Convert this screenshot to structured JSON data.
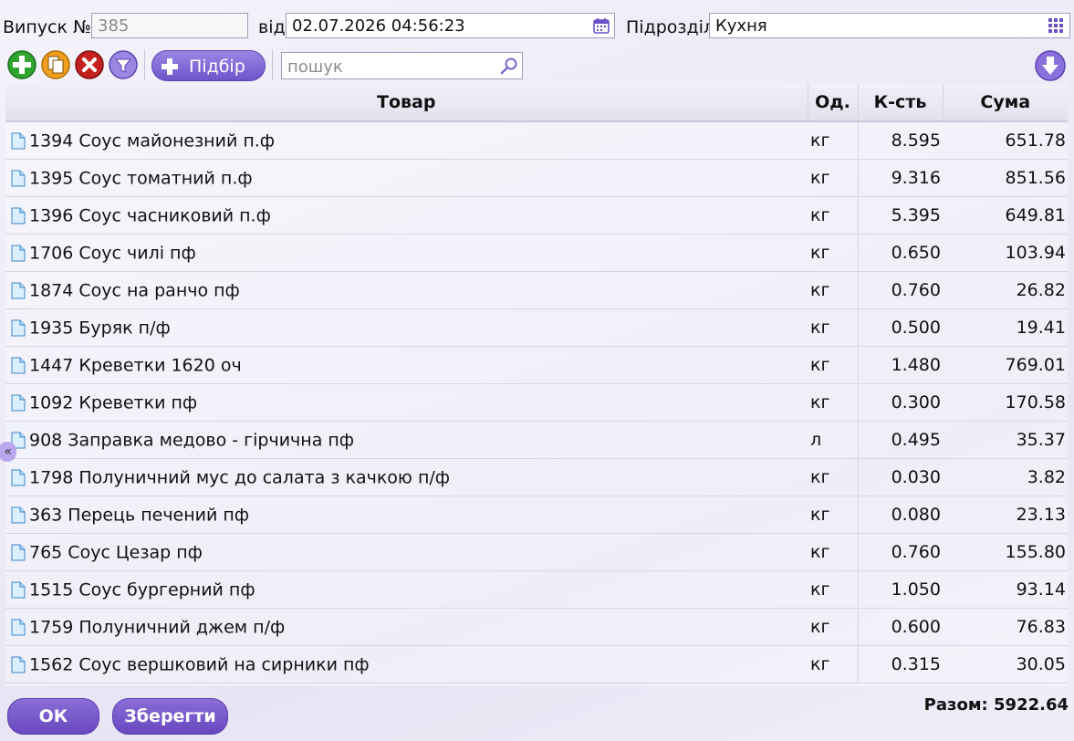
{
  "header": {
    "issue_label": "Випуск №",
    "issue_number": "385",
    "date_label": "від",
    "date_value": "02.07.2026 04:56:23",
    "dept_label": "Підрозділ",
    "dept_value": "Кухня"
  },
  "toolbar": {
    "add_icon": "plus-circle-icon",
    "copy_icon": "copy-icon",
    "delete_icon": "delete-x-icon",
    "filter_icon": "filter-funnel-icon",
    "pick_label": "Підбір",
    "search_placeholder": "пошук",
    "download_icon": "arrow-down-icon"
  },
  "table": {
    "columns": [
      "Товар",
      "Од.",
      "К-сть",
      "Сума"
    ],
    "rows": [
      {
        "name": "1394 Соус майонезний п.ф",
        "unit": "кг",
        "qty": "8.595",
        "sum": "651.78"
      },
      {
        "name": "1395 Соус томатний п.ф",
        "unit": "кг",
        "qty": "9.316",
        "sum": "851.56"
      },
      {
        "name": "1396 Соус часниковий п.ф",
        "unit": "кг",
        "qty": "5.395",
        "sum": "649.81"
      },
      {
        "name": "1706 Соус чилі пф",
        "unit": "кг",
        "qty": "0.650",
        "sum": "103.94"
      },
      {
        "name": "1874 Соус на ранчо пф",
        "unit": "кг",
        "qty": "0.760",
        "sum": "26.82"
      },
      {
        "name": "1935 Буряк п/ф",
        "unit": "кг",
        "qty": "0.500",
        "sum": "19.41"
      },
      {
        "name": "1447 Креветки 1620 оч",
        "unit": "кг",
        "qty": "1.480",
        "sum": "769.01"
      },
      {
        "name": "1092 Креветки пф",
        "unit": "кг",
        "qty": "0.300",
        "sum": "170.58"
      },
      {
        "name": "908 Заправка медово - гірчична пф",
        "unit": "л",
        "qty": "0.495",
        "sum": "35.37"
      },
      {
        "name": "1798 Полуничний мус до салата з качкою п/ф",
        "unit": "кг",
        "qty": "0.030",
        "sum": "3.82"
      },
      {
        "name": "363 Перець печений пф",
        "unit": "кг",
        "qty": "0.080",
        "sum": "23.13"
      },
      {
        "name": "765 Соус Цезар пф",
        "unit": "кг",
        "qty": "0.760",
        "sum": "155.80"
      },
      {
        "name": "1515 Соус бургерний пф",
        "unit": "кг",
        "qty": "1.050",
        "sum": "93.14"
      },
      {
        "name": "1759 Полуничний джем п/ф",
        "unit": "кг",
        "qty": "0.600",
        "sum": "76.83"
      },
      {
        "name": "1562 Соус вершковий на сирники пф",
        "unit": "кг",
        "qty": "0.315",
        "sum": "30.05"
      }
    ]
  },
  "footer": {
    "ok_label": "ОК",
    "save_label": "Зберегти",
    "total_text": "Разом: 5922.64"
  },
  "side": {
    "collapse_glyph": "«"
  },
  "colors": {
    "accent": "#6d55c9",
    "add": "#2fa52f",
    "copy": "#f0a020",
    "delete": "#c42020"
  }
}
